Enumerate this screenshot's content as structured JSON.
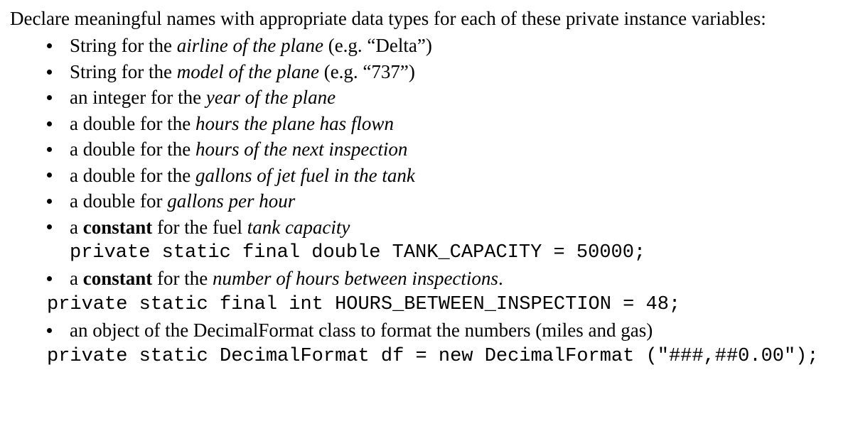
{
  "intro": "Declare meaningful names with appropriate data types for each of these private instance variables:",
  "items": [
    {
      "prefix": "String for the ",
      "italic": "airline of the plane",
      "suffix": " (e.g. “Delta”)"
    },
    {
      "prefix": "String for the ",
      "italic": "model of the plane",
      "suffix": " (e.g. “737”)"
    },
    {
      "prefix": "an integer for the ",
      "italic": "year of the plane",
      "suffix": ""
    },
    {
      "prefix": "a double for the ",
      "italic": "hours the plane has flown",
      "suffix": ""
    },
    {
      "prefix": "a double for the ",
      "italic": "hours of the next inspection",
      "suffix": ""
    },
    {
      "prefix": "a double for the ",
      "italic": "gallons of jet fuel in the tank",
      "suffix": ""
    },
    {
      "prefix": "a double for ",
      "italic": "gallons per hour",
      "suffix": ""
    },
    {
      "prefix": "a ",
      "bold": "constant",
      "mid": " for the fuel ",
      "italic": "tank capacity",
      "suffix": "",
      "code": "private static final double TANK_CAPACITY = 50000;",
      "codeClass": ""
    },
    {
      "prefix": "a ",
      "bold": "constant",
      "mid": " for the ",
      "italic": "number of hours between inspections",
      "suffix": ".",
      "code": "private static final int HOURS_BETWEEN_INSPECTION = 48;",
      "codeClass": "code-outdent"
    },
    {
      "prefix": "an object of the DecimalFormat class to format the numbers (miles and gas)",
      "suffix": "",
      "code": "private static DecimalFormat df = new DecimalFormat (\"###,##0.00\");",
      "codeClass": "code-outdent"
    }
  ]
}
